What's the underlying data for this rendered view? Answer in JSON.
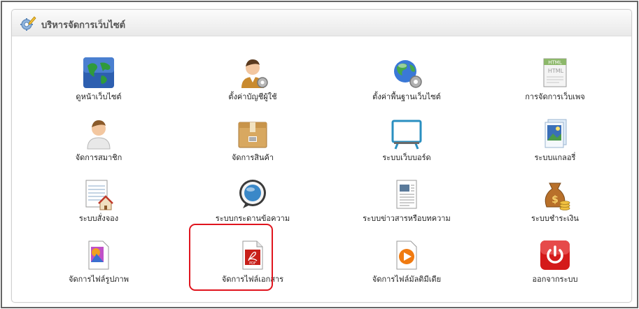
{
  "panel": {
    "title": "บริหารจัดการเว็บไซต์",
    "title_icon": "gear-pencil-icon"
  },
  "items": [
    {
      "label": "ดูหน้าเว็บไซต์",
      "icon": "globe-icon"
    },
    {
      "label": "ตั้งค่าบัญชีผู้ใช้",
      "icon": "user-gear-icon"
    },
    {
      "label": "ตั้งค่าพื้นฐานเว็บไซต์",
      "icon": "globe-gear-icon"
    },
    {
      "label": "การจัดการเว็บเพจ",
      "icon": "html-page-icon"
    },
    {
      "label": "จัดการสมาชิก",
      "icon": "member-icon"
    },
    {
      "label": "จัดการสินค้า",
      "icon": "product-box-icon"
    },
    {
      "label": "ระบบเว็บบอร์ด",
      "icon": "webboard-icon"
    },
    {
      "label": "ระบบแกลอรี่",
      "icon": "gallery-icon"
    },
    {
      "label": "ระบบสั่งจอง",
      "icon": "booking-icon"
    },
    {
      "label": "ระบบกระดานข้อความ",
      "icon": "message-bubble-icon"
    },
    {
      "label": "ระบบข่าวสารหรือบทความ",
      "icon": "news-article-icon"
    },
    {
      "label": "ระบบชำระเงิน",
      "icon": "money-bag-icon"
    },
    {
      "label": "จัดการไฟล์รูปภาพ",
      "icon": "image-file-icon"
    },
    {
      "label": "จัดการไฟล์เอกสาร",
      "icon": "pdf-file-icon",
      "highlighted": true
    },
    {
      "label": "จัดการไฟล์มัลติมีเดีย",
      "icon": "media-file-icon"
    },
    {
      "label": "ออกจากระบบ",
      "icon": "power-icon"
    }
  ],
  "colors": {
    "highlight": "#e0151e",
    "frame_border": "#666666"
  }
}
